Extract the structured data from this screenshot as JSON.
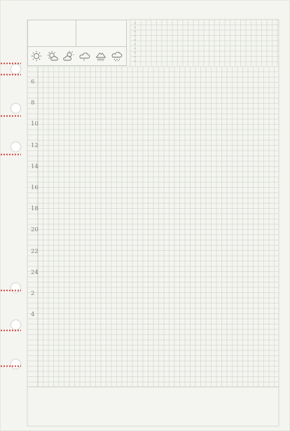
{
  "page": {
    "paper_color": "#f4f5f0",
    "grid_color": "#c7cac3",
    "major_line_color": "#b9bcb5",
    "hole_color": "#ffffff",
    "perforation_color": "#d03030"
  },
  "weather_icons": [
    {
      "name": "sunny-icon"
    },
    {
      "name": "sunny-cloudy-icon"
    },
    {
      "name": "partly-cloudy-icon"
    },
    {
      "name": "cloudy-icon"
    },
    {
      "name": "rain-icon"
    },
    {
      "name": "snow-icon"
    }
  ],
  "hour_labels": [
    "6",
    "8",
    "10",
    "12",
    "14",
    "16",
    "18",
    "20",
    "22",
    "24",
    "2",
    "4"
  ]
}
